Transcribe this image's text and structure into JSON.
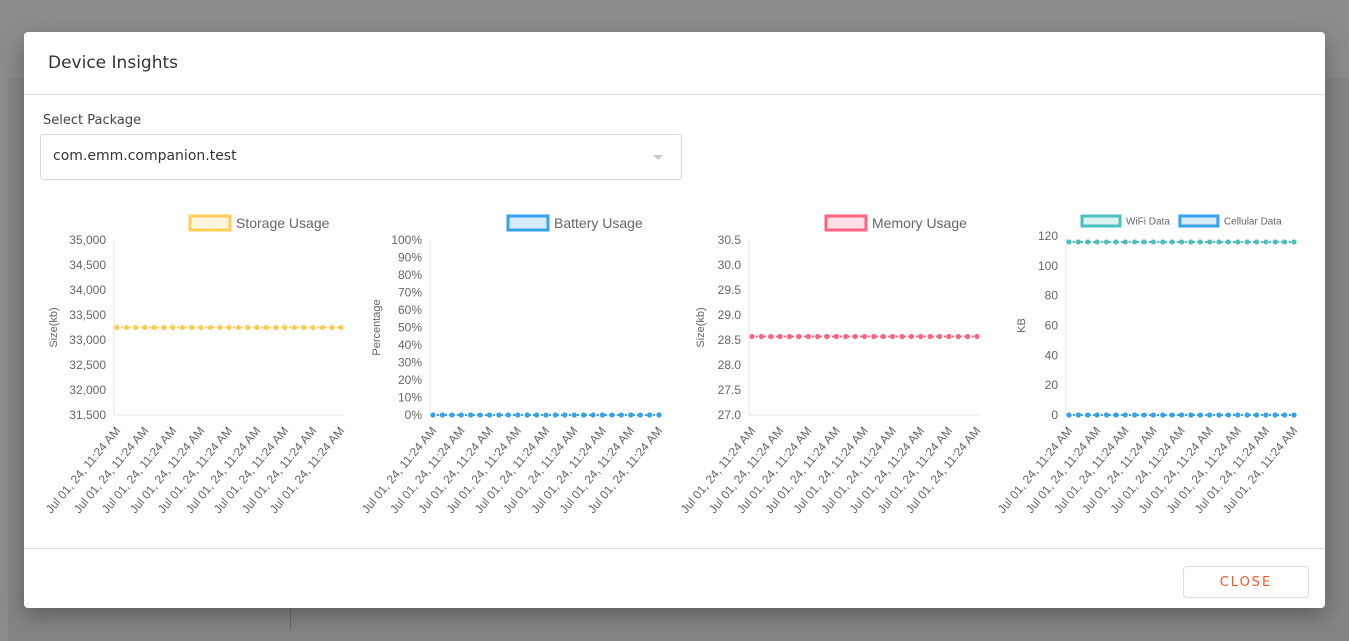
{
  "modal": {
    "title": "Device Insights",
    "select_label": "Select Package",
    "select_value": "com.emm.companion.test",
    "close_label": "CLOSE"
  },
  "colors": {
    "accent": "#f4592b",
    "storage": "#ffcd56",
    "battery": "#36a2eb",
    "memory": "#ff6384",
    "wifi": "#4bc0c0",
    "cellular": "#36a2eb"
  },
  "chart_data": [
    {
      "type": "line",
      "ylabel": "Size(kb)",
      "ylim": [
        31500,
        35000
      ],
      "yticks": [
        "31,500",
        "32,000",
        "32,500",
        "33,000",
        "33,500",
        "34,000",
        "34,500",
        "35,000"
      ],
      "ytick_values": [
        31500,
        32000,
        32500,
        33000,
        33500,
        34000,
        34500,
        35000
      ],
      "x": [
        "Jul 01, 24, 11:24 AM",
        "Jul 01, 24, 11:24 AM",
        "Jul 01, 24, 11:24 AM",
        "Jul 01, 24, 11:24 AM",
        "Jul 01, 24, 11:24 AM",
        "Jul 01, 24, 11:24 AM",
        "Jul 01, 24, 11:24 AM",
        "Jul 01, 24, 11:24 AM",
        "Jul 01, 24, 11:24 AM",
        "Jul 01, 24, 11:24 AM",
        "Jul 01, 24, 11:24 AM",
        "Jul 01, 24, 11:24 AM",
        "Jul 01, 24, 11:24 AM",
        "Jul 01, 24, 11:24 AM",
        "Jul 01, 24, 11:24 AM",
        "Jul 01, 24, 11:24 AM",
        "Jul 01, 24, 11:24 AM",
        "Jul 01, 24, 11:24 AM",
        "Jul 01, 24, 11:24 AM",
        "Jul 01, 24, 11:24 AM",
        "Jul 01, 24, 11:24 AM",
        "Jul 01, 24, 11:24 AM",
        "Jul 01, 24, 11:24 AM",
        "Jul 01, 24, 11:24 AM",
        "Jul 01, 24, 11:24 AM"
      ],
      "series": [
        {
          "name": "Storage Usage",
          "color": "#ffcd56",
          "values": [
            33250,
            33250,
            33250,
            33250,
            33250,
            33250,
            33250,
            33250,
            33250,
            33250,
            33250,
            33250,
            33250,
            33250,
            33250,
            33250,
            33250,
            33250,
            33250,
            33250,
            33250,
            33250,
            33250,
            33250,
            33250
          ]
        }
      ],
      "legend": "top"
    },
    {
      "type": "line",
      "ylabel": "Percentage",
      "ylim": [
        0,
        100
      ],
      "yticks": [
        "0%",
        "10%",
        "20%",
        "30%",
        "40%",
        "50%",
        "60%",
        "70%",
        "80%",
        "90%",
        "100%"
      ],
      "ytick_values": [
        0,
        10,
        20,
        30,
        40,
        50,
        60,
        70,
        80,
        90,
        100
      ],
      "x": [
        "Jul 01, 24, 11:24 AM",
        "Jul 01, 24, 11:24 AM",
        "Jul 01, 24, 11:24 AM",
        "Jul 01, 24, 11:24 AM",
        "Jul 01, 24, 11:24 AM",
        "Jul 01, 24, 11:24 AM",
        "Jul 01, 24, 11:24 AM",
        "Jul 01, 24, 11:24 AM",
        "Jul 01, 24, 11:24 AM",
        "Jul 01, 24, 11:24 AM",
        "Jul 01, 24, 11:24 AM",
        "Jul 01, 24, 11:24 AM",
        "Jul 01, 24, 11:24 AM",
        "Jul 01, 24, 11:24 AM",
        "Jul 01, 24, 11:24 AM",
        "Jul 01, 24, 11:24 AM",
        "Jul 01, 24, 11:24 AM",
        "Jul 01, 24, 11:24 AM",
        "Jul 01, 24, 11:24 AM",
        "Jul 01, 24, 11:24 AM",
        "Jul 01, 24, 11:24 AM",
        "Jul 01, 24, 11:24 AM",
        "Jul 01, 24, 11:24 AM",
        "Jul 01, 24, 11:24 AM",
        "Jul 01, 24, 11:24 AM"
      ],
      "series": [
        {
          "name": "Battery Usage",
          "color": "#36a2eb",
          "values": [
            0,
            0,
            0,
            0,
            0,
            0,
            0,
            0,
            0,
            0,
            0,
            0,
            0,
            0,
            0,
            0,
            0,
            0,
            0,
            0,
            0,
            0,
            0,
            0,
            0
          ]
        }
      ],
      "legend": "top"
    },
    {
      "type": "line",
      "ylabel": "Size(kb)",
      "ylim": [
        27.0,
        30.5
      ],
      "yticks": [
        "27.0",
        "27.5",
        "28.0",
        "28.5",
        "29.0",
        "29.5",
        "30.0",
        "30.5"
      ],
      "ytick_values": [
        27.0,
        27.5,
        28.0,
        28.5,
        29.0,
        29.5,
        30.0,
        30.5
      ],
      "x": [
        "Jul 01, 24, 11:24 AM",
        "Jul 01, 24, 11:24 AM",
        "Jul 01, 24, 11:24 AM",
        "Jul 01, 24, 11:24 AM",
        "Jul 01, 24, 11:24 AM",
        "Jul 01, 24, 11:24 AM",
        "Jul 01, 24, 11:24 AM",
        "Jul 01, 24, 11:24 AM",
        "Jul 01, 24, 11:24 AM",
        "Jul 01, 24, 11:24 AM",
        "Jul 01, 24, 11:24 AM",
        "Jul 01, 24, 11:24 AM",
        "Jul 01, 24, 11:24 AM",
        "Jul 01, 24, 11:24 AM",
        "Jul 01, 24, 11:24 AM",
        "Jul 01, 24, 11:24 AM",
        "Jul 01, 24, 11:24 AM",
        "Jul 01, 24, 11:24 AM",
        "Jul 01, 24, 11:24 AM",
        "Jul 01, 24, 11:24 AM",
        "Jul 01, 24, 11:24 AM",
        "Jul 01, 24, 11:24 AM",
        "Jul 01, 24, 11:24 AM",
        "Jul 01, 24, 11:24 AM",
        "Jul 01, 24, 11:24 AM"
      ],
      "series": [
        {
          "name": "Memory Usage",
          "color": "#ff6384",
          "values": [
            28.57,
            28.57,
            28.57,
            28.57,
            28.57,
            28.57,
            28.57,
            28.57,
            28.57,
            28.57,
            28.57,
            28.57,
            28.57,
            28.57,
            28.57,
            28.57,
            28.57,
            28.57,
            28.57,
            28.57,
            28.57,
            28.57,
            28.57,
            28.57,
            28.57
          ]
        }
      ],
      "legend": "top"
    },
    {
      "type": "line",
      "ylabel": "KB",
      "ylim": [
        0,
        120
      ],
      "yticks": [
        "0",
        "20",
        "40",
        "60",
        "80",
        "100",
        "120"
      ],
      "ytick_values": [
        0,
        20,
        40,
        60,
        80,
        100,
        120
      ],
      "x": [
        "Jul 01, 24, 11:24 AM",
        "Jul 01, 24, 11:24 AM",
        "Jul 01, 24, 11:24 AM",
        "Jul 01, 24, 11:24 AM",
        "Jul 01, 24, 11:24 AM",
        "Jul 01, 24, 11:24 AM",
        "Jul 01, 24, 11:24 AM",
        "Jul 01, 24, 11:24 AM",
        "Jul 01, 24, 11:24 AM",
        "Jul 01, 24, 11:24 AM",
        "Jul 01, 24, 11:24 AM",
        "Jul 01, 24, 11:24 AM",
        "Jul 01, 24, 11:24 AM",
        "Jul 01, 24, 11:24 AM",
        "Jul 01, 24, 11:24 AM",
        "Jul 01, 24, 11:24 AM",
        "Jul 01, 24, 11:24 AM",
        "Jul 01, 24, 11:24 AM",
        "Jul 01, 24, 11:24 AM",
        "Jul 01, 24, 11:24 AM",
        "Jul 01, 24, 11:24 AM",
        "Jul 01, 24, 11:24 AM",
        "Jul 01, 24, 11:24 AM",
        "Jul 01, 24, 11:24 AM",
        "Jul 01, 24, 11:24 AM"
      ],
      "series": [
        {
          "name": "WiFi Data",
          "color": "#4bc0c0",
          "values": [
            116,
            116,
            116,
            116,
            116,
            116,
            116,
            116,
            116,
            116,
            116,
            116,
            116,
            116,
            116,
            116,
            116,
            116,
            116,
            116,
            116,
            116,
            116,
            116,
            116
          ]
        },
        {
          "name": "Cellular Data",
          "color": "#36a2eb",
          "values": [
            0,
            0,
            0,
            0,
            0,
            0,
            0,
            0,
            0,
            0,
            0,
            0,
            0,
            0,
            0,
            0,
            0,
            0,
            0,
            0,
            0,
            0,
            0,
            0,
            0
          ]
        }
      ],
      "legend": "top"
    }
  ]
}
